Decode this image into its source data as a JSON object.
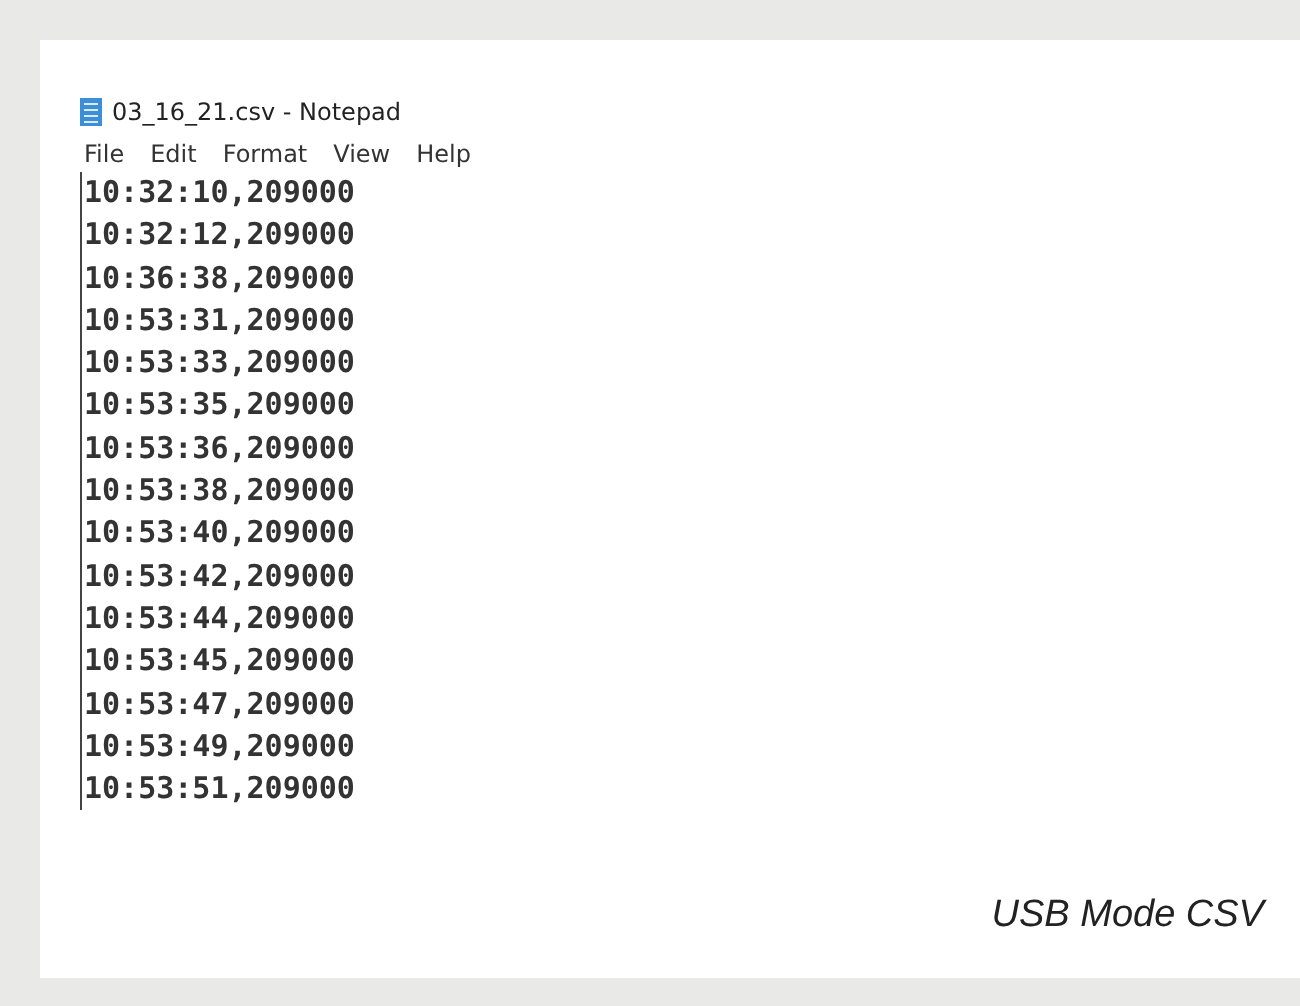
{
  "window": {
    "title": "03_16_21.csv - Notepad"
  },
  "menu": [
    "File",
    "Edit",
    "Format",
    "View",
    "Help"
  ],
  "lines": [
    "10:32:10,209000",
    "10:32:12,209000",
    "10:36:38,209000",
    "10:53:31,209000",
    "10:53:33,209000",
    "10:53:35,209000",
    "10:53:36,209000",
    "10:53:38,209000",
    "10:53:40,209000",
    "10:53:42,209000",
    "10:53:44,209000",
    "10:53:45,209000",
    "10:53:47,209000",
    "10:53:49,209000",
    "10:53:51,209000"
  ],
  "caption": "USB Mode CSV"
}
